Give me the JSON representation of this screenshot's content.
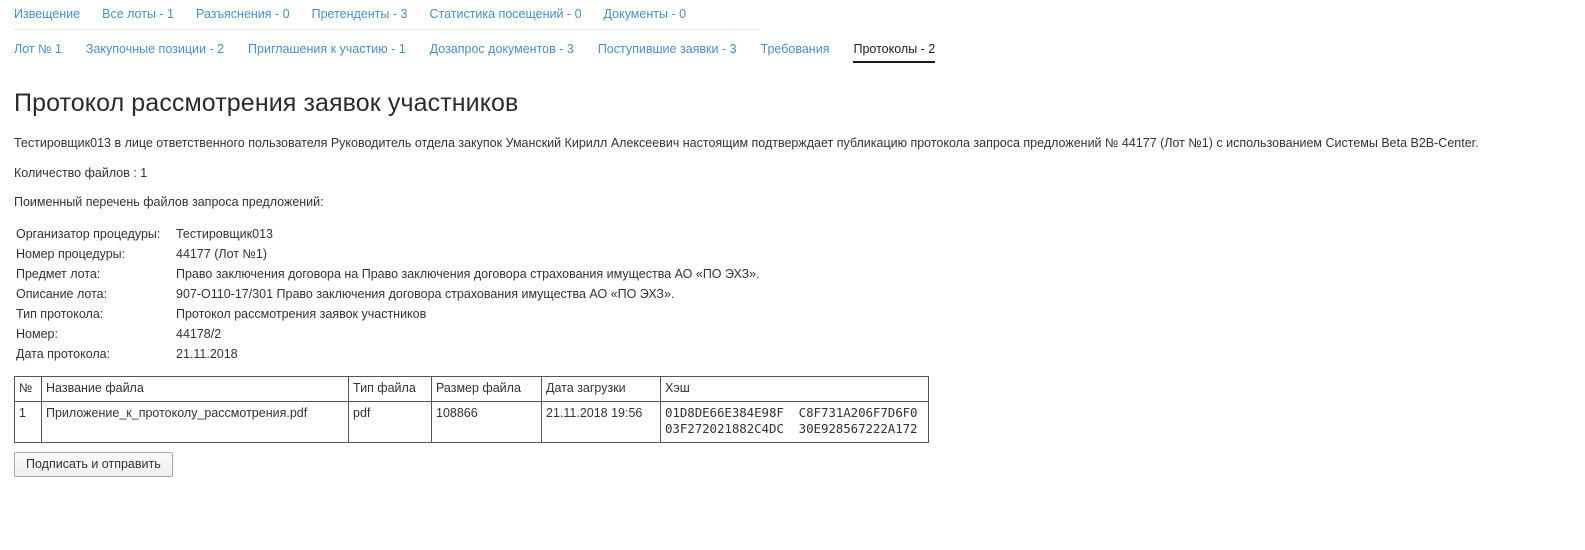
{
  "primary_tabs": [
    {
      "label": "Извещение",
      "active": false
    },
    {
      "label": "Все лоты - 1",
      "active": false
    },
    {
      "label": "Разъяснения - 0",
      "active": false
    },
    {
      "label": "Претенденты - 3",
      "active": false
    },
    {
      "label": "Статистика посещений - 0",
      "active": false
    },
    {
      "label": "Документы - 0",
      "active": false
    }
  ],
  "secondary_tabs": [
    {
      "label": "Лот № 1",
      "active": false
    },
    {
      "label": "Закупочные позиции - 2",
      "active": false
    },
    {
      "label": "Приглашения к участию - 1",
      "active": false
    },
    {
      "label": "Дозапрос документов - 3",
      "active": false
    },
    {
      "label": "Поступившие заявки - 3",
      "active": false
    },
    {
      "label": "Требования",
      "active": false
    },
    {
      "label": "Протоколы - 2",
      "active": true
    }
  ],
  "page": {
    "title": "Протокол рассмотрения заявок участников",
    "intro": "Тестировщик013 в лице ответственного пользователя Руководитель отдела закупок Уманский Кирилл Алексеевич настоящим подтверждает публикацию протокола запроса предложений № 44177 (Лот №1) с использованием Системы Beta B2B-Center.",
    "files_count_line": "Количество файлов : 1",
    "files_list_heading": "Поименный перечень файлов запроса предложений:"
  },
  "details": [
    {
      "label": "Организатор процедуры:",
      "value": "Тестировщик013"
    },
    {
      "label": "Номер процедуры:",
      "value": "44177 (Лот №1)"
    },
    {
      "label": "Предмет лота:",
      "value": "Право заключения договора на Право заключения договора страхования имущества АО «ПО ЭХЗ»."
    },
    {
      "label": "Описание лота:",
      "value": "907-O110-17/301 Право заключения договора страхования имущества АО «ПО ЭХЗ»."
    },
    {
      "label": "Тип протокола:",
      "value": "Протокол рассмотрения заявок участников"
    },
    {
      "label": "Номер:",
      "value": "44178/2"
    },
    {
      "label": "Дата протокола:",
      "value": "21.11.2018"
    }
  ],
  "files_table": {
    "headers": [
      "№",
      "Название файла",
      "Тип файла",
      "Размер файла",
      "Дата загрузки",
      "Хэш"
    ],
    "rows": [
      {
        "num": "1",
        "name": "Приложение_к_протоколу_рассмотрения.pdf",
        "type": "pdf",
        "size": "108866",
        "date": "21.11.2018 19:56",
        "hash": "01D8DE66E384E98F  C8F731A206F7D6F0\n03F272021882C4DC  30E928567222A172"
      }
    ]
  },
  "actions": {
    "submit_label": "Подписать и отправить"
  },
  "colors": {
    "link": "#4a8fc4",
    "active_tab_text": "#222222",
    "body_text": "#333333",
    "table_border": "#555555",
    "divider": "#e6e6e6"
  }
}
